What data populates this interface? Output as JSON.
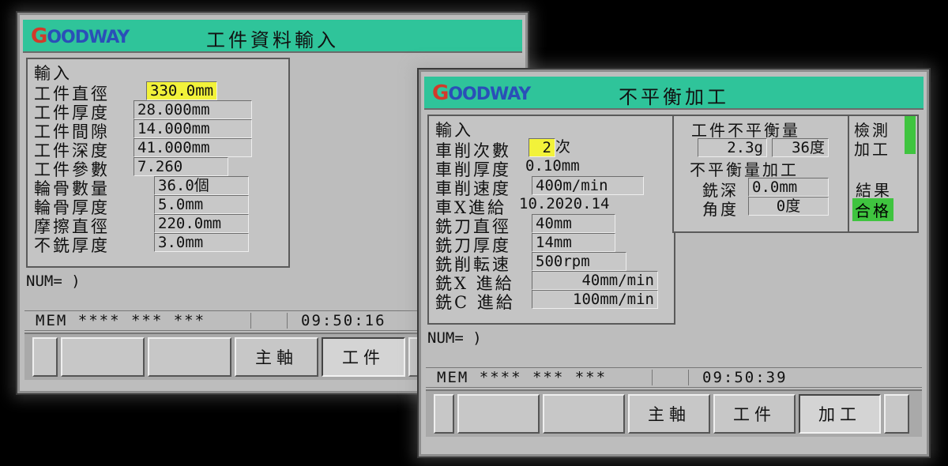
{
  "screen1": {
    "logo": "GOODWAY",
    "title": "工件資料輸入",
    "section_label": "輸入",
    "rows": [
      {
        "label": "工件直徑",
        "value": "330.0mm",
        "highlight": true
      },
      {
        "label": "工件厚度",
        "value": "28.000mm"
      },
      {
        "label": "工件間隙",
        "value": "14.000mm"
      },
      {
        "label": "工件深度",
        "value": "41.000mm"
      },
      {
        "label": "工件參數",
        "value": "7.260"
      },
      {
        "label": "輪骨數量",
        "value": "36.0個"
      },
      {
        "label": "輪骨厚度",
        "value": "5.0mm"
      },
      {
        "label": "摩擦直徑",
        "value": "220.0mm"
      },
      {
        "label": "不銑厚度",
        "value": "3.0mm"
      }
    ],
    "num_prompt": "NUM= )",
    "status": {
      "mem": "MEM  **** *** ***",
      "time": "09:50:16"
    },
    "softkeys": [
      "",
      "",
      "",
      "主軸",
      "工件",
      ""
    ],
    "active_softkey": 4
  },
  "screen2": {
    "logo": "GOODWAY",
    "title": "不平衡加工",
    "section_label": "輸入",
    "rows": [
      {
        "label": "車削次數",
        "value": "2",
        "suffix": "次",
        "highlight": true
      },
      {
        "label": "車削厚度",
        "value": "0.10mm",
        "inline": true
      },
      {
        "label": "車削速度",
        "value": "400m/min"
      },
      {
        "label": "車X進給",
        "value": "10.2020.14"
      },
      {
        "label": "銑刀直徑",
        "value": "40mm"
      },
      {
        "label": "銑刀厚度",
        "value": "14mm"
      },
      {
        "label": "銑削転速",
        "value": "500rpm"
      },
      {
        "label": "銑X 進給",
        "value": "40mm/min"
      },
      {
        "label": "銑C 進給",
        "value": "100mm/min"
      }
    ],
    "right": {
      "imbalance_label": "工件不平衡量",
      "imbalance_value": "2.3g",
      "imbalance_angle": "36度",
      "machining_label": "不平衡量加工",
      "depth_label": "銑深",
      "depth_value": "0.0mm",
      "angle_label": "角度",
      "angle_value": "0度",
      "side_top": "檢測",
      "side_mid": "加工",
      "side_result": "結果",
      "side_badge": "合格"
    },
    "num_prompt": "NUM= )",
    "status": {
      "mem": "MEM  **** *** ***",
      "time": "09:50:39"
    },
    "softkeys": [
      "",
      "",
      "",
      "主軸",
      "工件",
      "加工",
      ""
    ],
    "active_softkey": 5,
    "colors": {
      "title_bar": "#2fc49a",
      "highlight": "#f2f23a",
      "ok": "#3fc43f"
    }
  }
}
